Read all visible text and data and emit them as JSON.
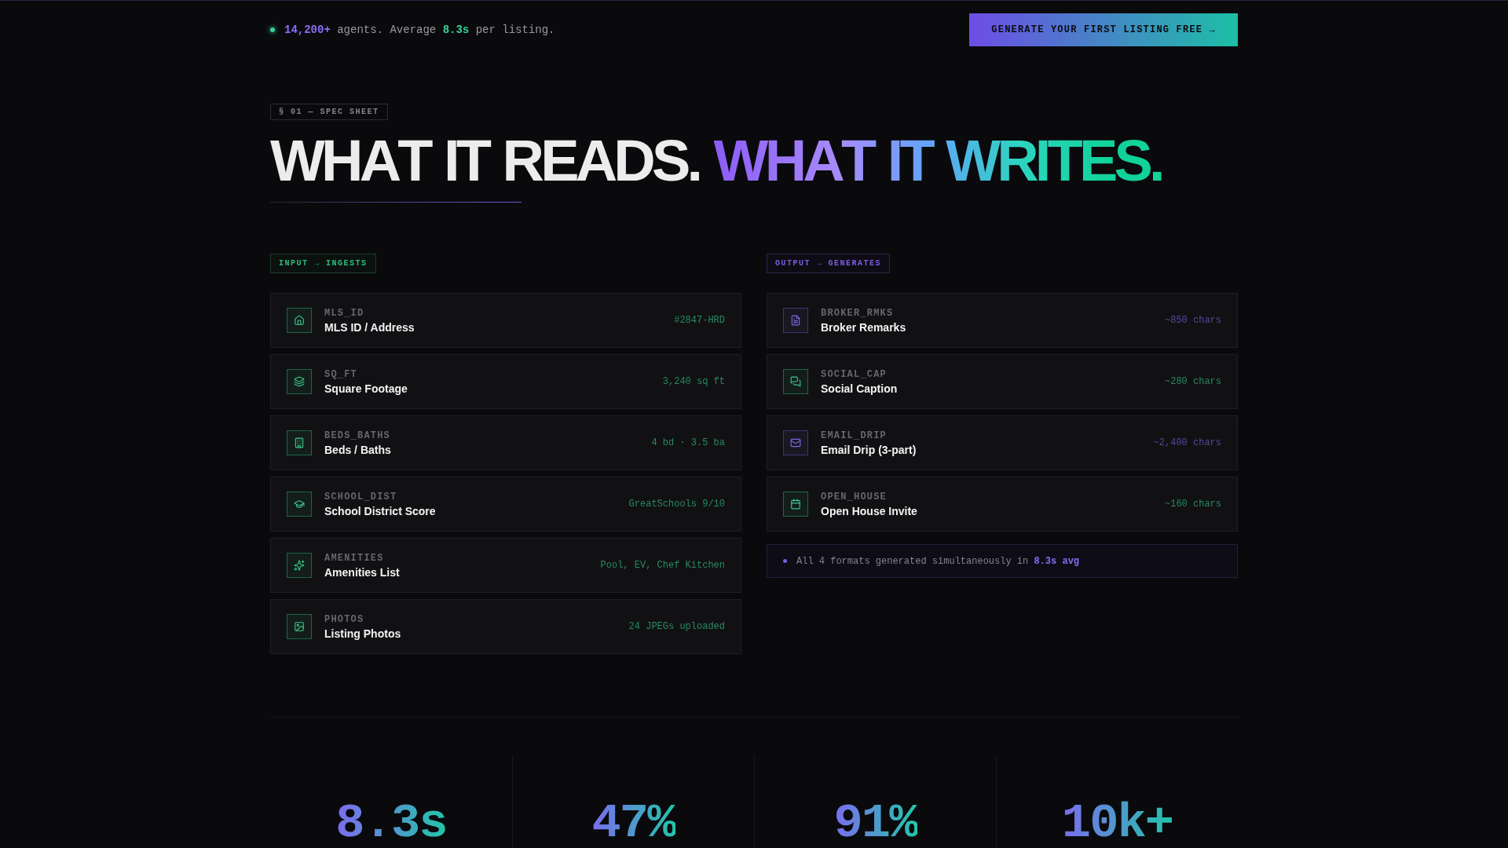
{
  "top_bar": {
    "tagline": "**14,200+** agents. Average **8.3s** per listing.",
    "cta_button": "GENERATE YOUR FIRST LISTING FREE →"
  },
  "section": {
    "tag": "§ 01 — SPEC SHEET",
    "heading": "WHAT IT READS.",
    "heading_accent": "WHAT IT WRITES."
  },
  "input": {
    "tag": "INPUT → INGESTS",
    "fields": [
      {
        "key": "MLS_ID",
        "title": "MLS ID / Address",
        "value": "#2847-HRD"
      },
      {
        "key": "SQ_FT",
        "title": "Square Footage",
        "value": "3,240 sq ft"
      },
      {
        "key": "BEDS_BATHS",
        "title": "Beds / Baths",
        "value": "4 bd · 3.5 ba"
      },
      {
        "key": "SCHOOL_DIST",
        "title": "School District Score",
        "value": "GreatSchools 9/10"
      },
      {
        "key": "AMENITIES",
        "title": "Amenities List",
        "value": "Pool, EV, Chef Kitchen"
      },
      {
        "key": "PHOTOS",
        "title": "Listing Photos",
        "value": "24 JPEGs uploaded"
      }
    ]
  },
  "output": {
    "tag": "OUTPUT → GENERATES",
    "formats": [
      {
        "key": "BROKER_RMKS",
        "title": "Broker Remarks",
        "value": "~850 chars",
        "color": "#3d3573"
      },
      {
        "key": "SOCIAL_CAP",
        "title": "Social Caption",
        "value": "~280 chars",
        "color": "#1e6446"
      },
      {
        "key": "EMAIL_DRIP",
        "title": "Email Drip (3-part)",
        "value": "~2,400 chars",
        "color": "#3d3573"
      },
      {
        "key": "OPEN_HOUSE",
        "title": "Open House Invite",
        "value": "~160 chars",
        "color": "#1e6446"
      }
    ],
    "note": "All 4 formats generated simultaneously in **8.3s avg**"
  },
  "stats": [
    "8.3s",
    "47%",
    "91%",
    "10k+"
  ]
}
